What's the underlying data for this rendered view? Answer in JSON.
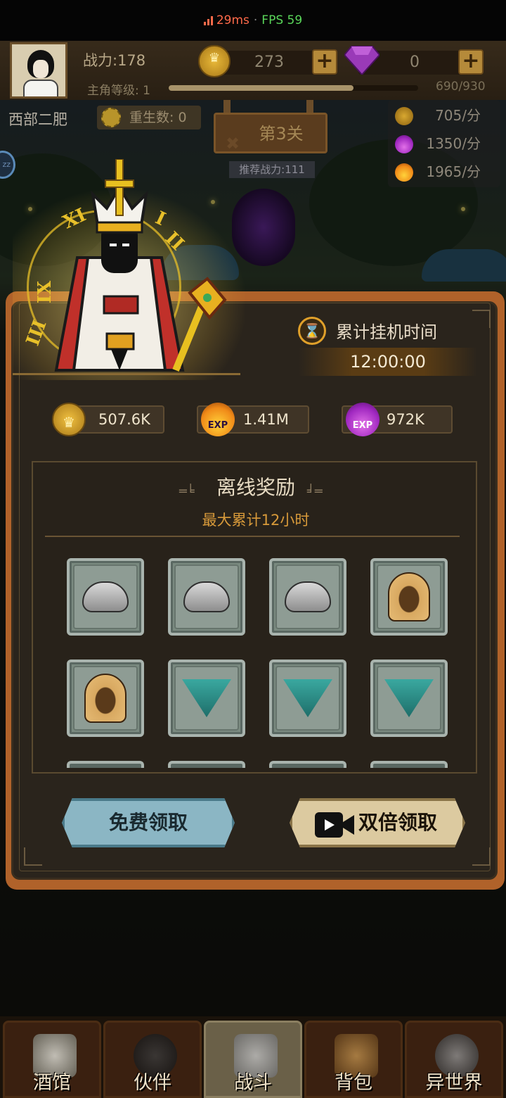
{
  "status": {
    "ping": "29ms",
    "separator": "·",
    "fps": "FPS 59"
  },
  "hud": {
    "power": "战力:178",
    "level_label": "主角等级: 1",
    "level_progress": "690/930",
    "level_fraction": 0.742,
    "gold": "273",
    "gems": "0",
    "plus": "+"
  },
  "player": {
    "name": "西部二肥",
    "rebirth": "重生数: 0"
  },
  "stage": {
    "name": "第3关",
    "recommended_power": "推荐战力:111"
  },
  "rates": [
    {
      "icon": "gold-coin-icon",
      "value": "705/分"
    },
    {
      "icon": "purple-exp-icon",
      "value": "1350/分"
    },
    {
      "icon": "fire-exp-icon",
      "value": "1965/分"
    }
  ],
  "clock_numerals": [
    "XI",
    "I",
    "II",
    "IX",
    "III"
  ],
  "idle": {
    "title": "累计挂机时间",
    "time": "12:00:00"
  },
  "resources": [
    {
      "icon": "gold-coin-icon",
      "value": "507.6K"
    },
    {
      "icon": "fire-exp-icon",
      "value": "1.41M",
      "tag": "EXP"
    },
    {
      "icon": "purple-exp-icon",
      "value": "972K",
      "tag": "EXP"
    }
  ],
  "rewards": {
    "title": "离线奖励",
    "subtitle": "最大累计12小时",
    "items": [
      "grey-bandana-icon",
      "grey-bandana-icon",
      "grey-bandana-icon",
      "leather-hood-icon",
      "leather-hood-icon",
      "teal-neckerchief-icon",
      "teal-neckerchief-icon",
      "teal-neckerchief-icon"
    ]
  },
  "buttons": {
    "free": "免费领取",
    "double": "双倍领取"
  },
  "nav": [
    {
      "label": "酒馆",
      "icon": "beer-mug-icon"
    },
    {
      "label": "伙伴",
      "icon": "partner-icon"
    },
    {
      "label": "战斗",
      "icon": "crossed-swords-icon"
    },
    {
      "label": "背包",
      "icon": "treasure-chest-icon"
    },
    {
      "label": "异世界",
      "icon": "portal-icon"
    }
  ],
  "colors": {
    "panel_border": "#b0622a",
    "accent_gold": "#e0a02a",
    "subtitle": "#d89a3a"
  }
}
